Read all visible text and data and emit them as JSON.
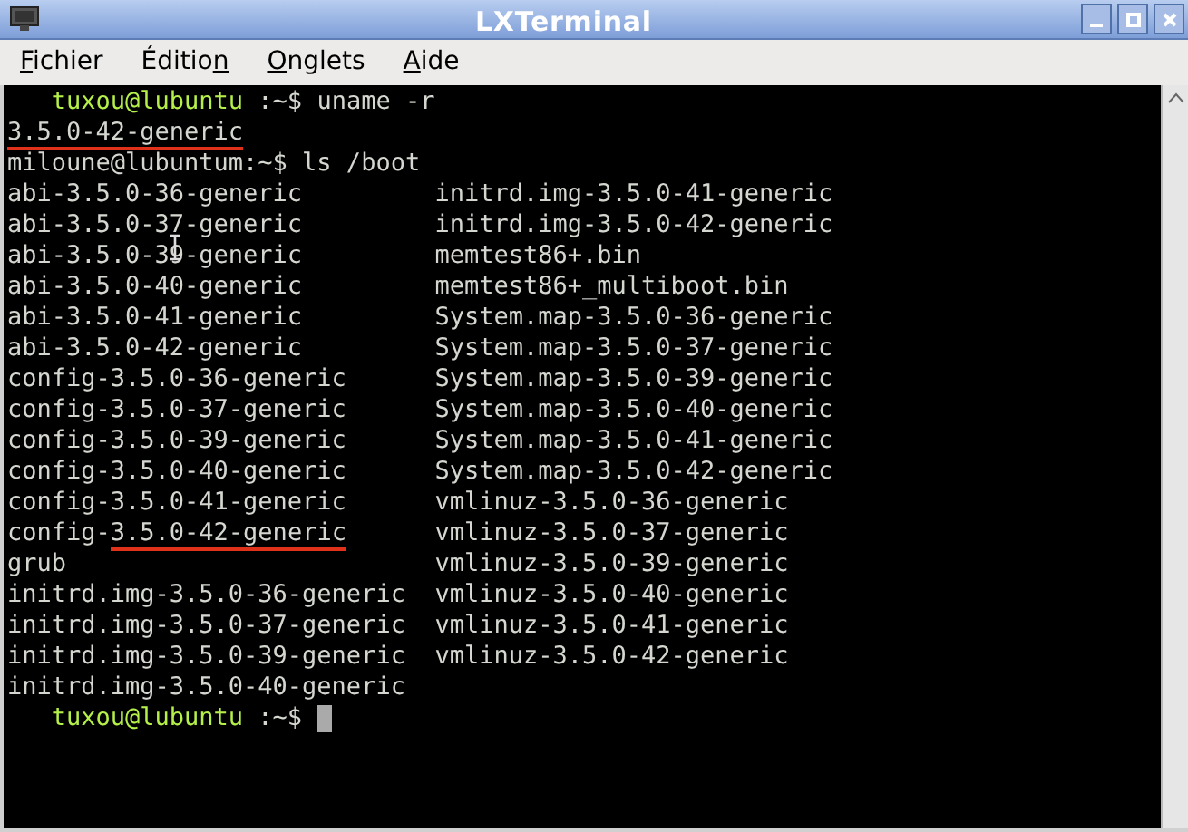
{
  "window": {
    "title": "LXTerminal"
  },
  "menu": [
    {
      "key": "F",
      "after": "ichier"
    },
    {
      "before": "Éditio",
      "key": "n"
    },
    {
      "key": "O",
      "after": "nglets"
    },
    {
      "key": "A",
      "after": "ide"
    }
  ],
  "terminal": {
    "lines": [
      {
        "kind": "prompt",
        "user": "tuxou@lubuntu",
        "path": ":~$",
        "command": "uname -r"
      },
      {
        "kind": "output",
        "left": [
          {
            "text": "3.5.0-42-generic",
            "marked": true
          }
        ]
      },
      {
        "kind": "plain",
        "text": "miloune@lubuntum:~$ ls /boot"
      },
      {
        "kind": "output",
        "left": [
          {
            "text": "abi-3.5.0-36-generic",
            "marked": false
          }
        ],
        "right": "initrd.img-3.5.0-41-generic"
      },
      {
        "kind": "output",
        "left": [
          {
            "text": "abi-3.5.0-37-generic",
            "marked": false
          }
        ],
        "right": "initrd.img-3.5.0-42-generic"
      },
      {
        "kind": "output",
        "left": [
          {
            "text": "abi-3.5.0-39-generic",
            "marked": false
          }
        ],
        "right": "memtest86+.bin",
        "pointer": true
      },
      {
        "kind": "output",
        "left": [
          {
            "text": "abi-3.5.0-40-generic",
            "marked": false
          }
        ],
        "right": "memtest86+_multiboot.bin"
      },
      {
        "kind": "output",
        "left": [
          {
            "text": "abi-3.5.0-41-generic",
            "marked": false
          }
        ],
        "right": "System.map-3.5.0-36-generic"
      },
      {
        "kind": "output",
        "left": [
          {
            "text": "abi-3.5.0-42-generic",
            "marked": false
          }
        ],
        "right": "System.map-3.5.0-37-generic"
      },
      {
        "kind": "output",
        "left": [
          {
            "text": "config-3.5.0-36-generic",
            "marked": false
          }
        ],
        "right": "System.map-3.5.0-39-generic"
      },
      {
        "kind": "output",
        "left": [
          {
            "text": "config-3.5.0-37-generic",
            "marked": false
          }
        ],
        "right": "System.map-3.5.0-40-generic"
      },
      {
        "kind": "output",
        "left": [
          {
            "text": "config-3.5.0-39-generic",
            "marked": false
          }
        ],
        "right": "System.map-3.5.0-41-generic"
      },
      {
        "kind": "output",
        "left": [
          {
            "text": "config-3.5.0-40-generic",
            "marked": false
          }
        ],
        "right": "System.map-3.5.0-42-generic"
      },
      {
        "kind": "output",
        "left": [
          {
            "text": "config-3.5.0-41-generic",
            "marked": false
          }
        ],
        "right": "vmlinuz-3.5.0-36-generic"
      },
      {
        "kind": "output",
        "left": [
          {
            "text": "config-",
            "marked": false
          },
          {
            "text": "3.5.0-42-generic",
            "marked": true
          }
        ],
        "right": "vmlinuz-3.5.0-37-generic"
      },
      {
        "kind": "output",
        "left": [
          {
            "text": "grub",
            "marked": false
          }
        ],
        "right": "vmlinuz-3.5.0-39-generic"
      },
      {
        "kind": "output",
        "left": [
          {
            "text": "initrd.img-3.5.0-36-generic",
            "marked": false
          }
        ],
        "right": "vmlinuz-3.5.0-40-generic"
      },
      {
        "kind": "output",
        "left": [
          {
            "text": "initrd.img-3.5.0-37-generic",
            "marked": false
          }
        ],
        "right": "vmlinuz-3.5.0-41-generic"
      },
      {
        "kind": "output",
        "left": [
          {
            "text": "initrd.img-3.5.0-39-generic",
            "marked": false
          }
        ],
        "right": "vmlinuz-3.5.0-42-generic"
      },
      {
        "kind": "output",
        "left": [
          {
            "text": "initrd.img-3.5.0-40-generic",
            "marked": false
          }
        ]
      },
      {
        "kind": "prompt",
        "user": "tuxou@lubuntu",
        "path": ":~$",
        "cursor": true
      }
    ]
  }
}
